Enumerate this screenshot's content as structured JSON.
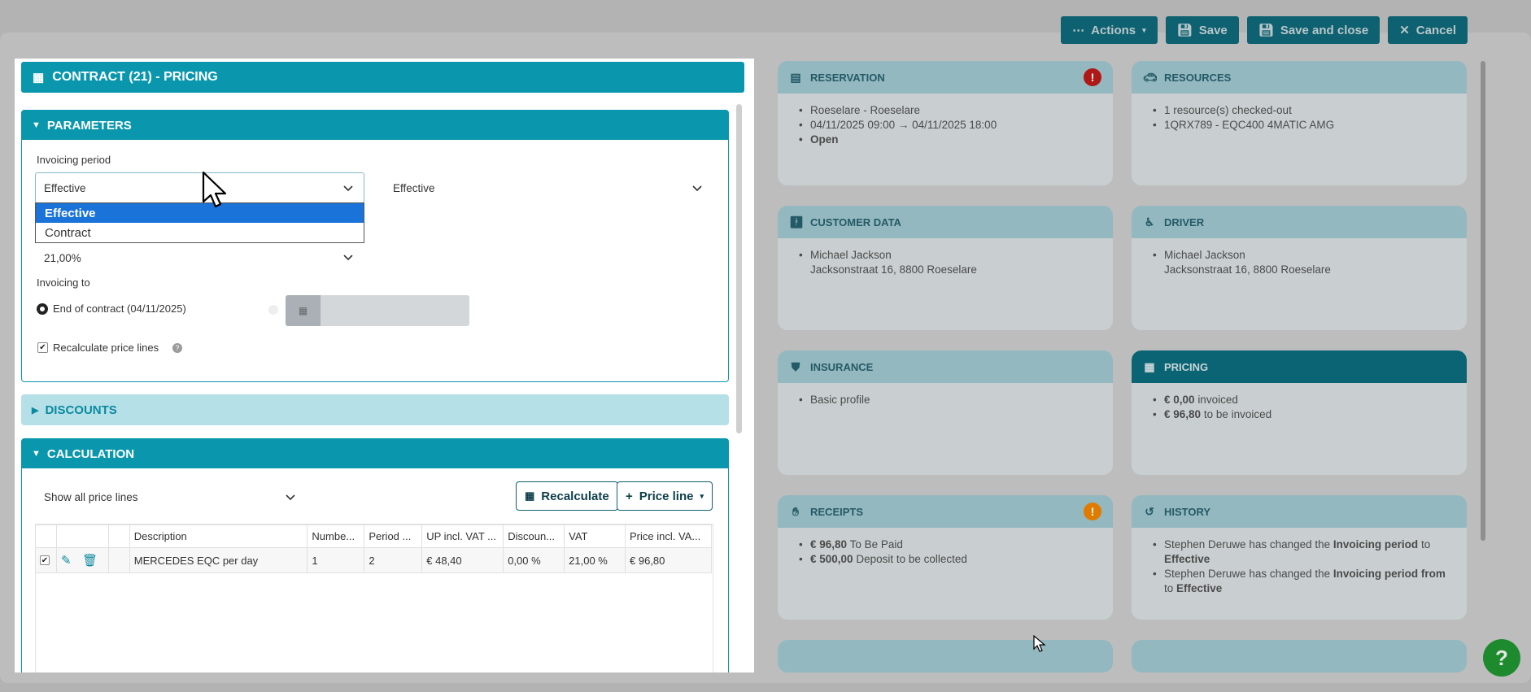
{
  "topbar": {
    "actions": "Actions",
    "save": "Save",
    "save_close": "Save and close",
    "cancel": "Cancel"
  },
  "cards": {
    "reservation": {
      "title": "RESERVATION",
      "items": [
        "Roeselare - Roeselare",
        "04/11/2025 09:00 → 04/11/2025 18:00",
        "Open"
      ],
      "alert": "!"
    },
    "resources": {
      "title": "RESOURCES",
      "items": [
        "1 resource(s) checked-out",
        "1QRX789 - EQC400 4MATIC AMG"
      ]
    },
    "customer": {
      "title": "CUSTOMER DATA",
      "line1": "Michael Jackson",
      "line2": "Jacksonstraat 16, 8800 Roeselare"
    },
    "driver": {
      "title": "DRIVER",
      "line1": "Michael Jackson",
      "line2": "Jacksonstraat 16, 8800 Roeselare"
    },
    "insurance": {
      "title": "INSURANCE",
      "items": [
        "Basic profile"
      ]
    },
    "pricing": {
      "title": "PRICING",
      "invoiced_amount": "€ 0,00",
      "invoiced_label": "invoiced",
      "tobe_amount": "€ 96,80",
      "tobe_label": "to be invoiced"
    },
    "receipts": {
      "title": "RECEIPTS",
      "alert": "!",
      "paid_amount": "€ 96,80",
      "paid_label": "To Be Paid",
      "deposit_amount": "€ 500,00",
      "deposit_label": "Deposit to be collected"
    },
    "history": {
      "title": "HISTORY",
      "h1_pre": "Stephen Deruwe has changed the",
      "h1_bold": "Invoicing period",
      "h1_mid": "to",
      "h1_val": "Effective",
      "h2_pre": "Stephen Deruwe has changed the",
      "h2_bold": "Invoicing period from",
      "h2_mid": "to",
      "h2_val": "Effective"
    }
  },
  "modal": {
    "title": "CONTRACT (21) - PRICING",
    "parameters": {
      "title": "PARAMETERS",
      "invoicing_period_label": "Invoicing period",
      "period_select": "Effective",
      "period_select_2": "Effective",
      "dropdown_options": [
        "Effective",
        "Contract"
      ],
      "vat_select": "21,00%",
      "invoicing_to_label": "Invoicing to",
      "end_of_contract": "End of contract (04/11/2025)",
      "recalc_lines": "Recalculate price lines"
    },
    "discounts": {
      "title": "DISCOUNTS"
    },
    "calculation": {
      "title": "CALCULATION",
      "filter_select": "Show all price lines",
      "recalculate": "Recalculate",
      "price_line": "Price line",
      "columns": [
        "Description",
        "Numbe...",
        "Period ...",
        "UP incl. VAT ...",
        "Discoun...",
        "VAT",
        "Price incl. VA..."
      ],
      "rows": [
        {
          "description": "MERCEDES EQC per day",
          "number": "1",
          "period": "2",
          "up": "€ 48,40",
          "discount": "0,00 %",
          "vat": "21,00 %",
          "price": "€ 96,80"
        }
      ]
    }
  },
  "help": "?"
}
